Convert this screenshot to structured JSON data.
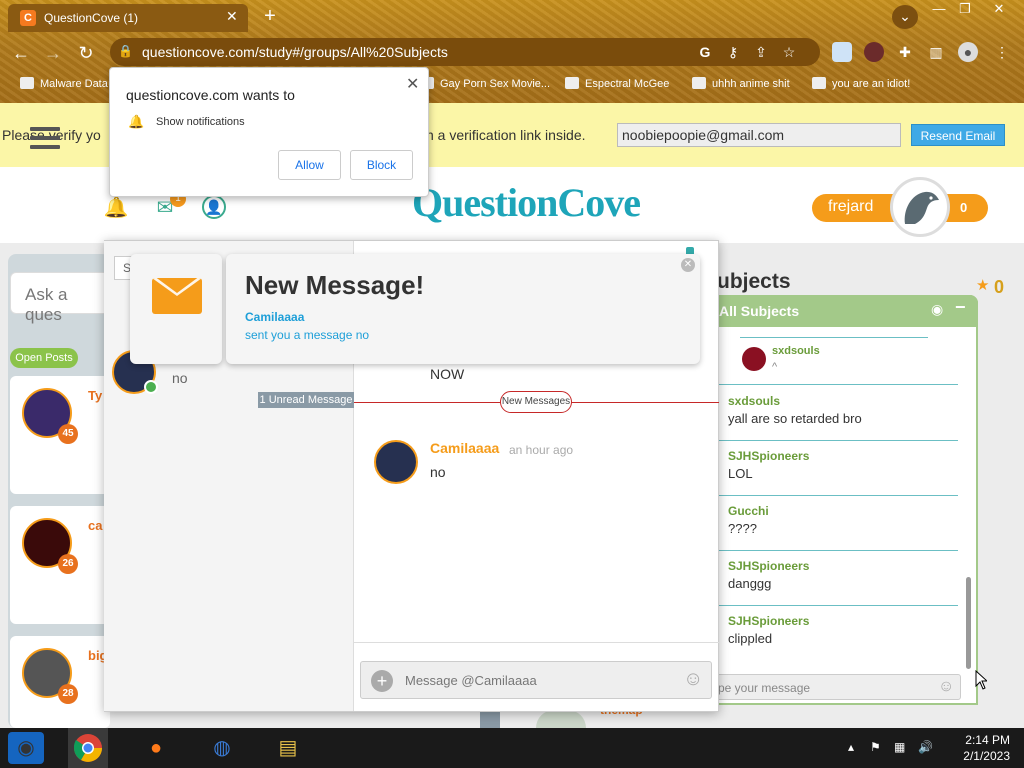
{
  "browser": {
    "tab_title": "QuestionCove (1)",
    "tab_favicon": "C",
    "url_main": "questioncove.com/study#/groups/All%20Subjects",
    "bookmarks": [
      "Malware Data",
      "Gay Porn Sex Movie...",
      "Espectral McGee",
      "uhhh anime shit",
      "you are an idiot!"
    ]
  },
  "notification_prompt": {
    "title": "questioncove.com wants to",
    "permission": "Show notifications",
    "allow": "Allow",
    "block": "Block"
  },
  "verify_bar": {
    "text_left": "Please verify yo",
    "text_right": "n a verification link inside.",
    "email": "noobiepoopie@gmail.com",
    "resend": "Resend Email"
  },
  "header": {
    "mail_badge": "1",
    "logo": "QuestionCove",
    "username": "frejard",
    "points": "0"
  },
  "left_col": {
    "ask_placeholder": "Ask a ques",
    "open_posts": "Open Posts",
    "cards": [
      {
        "name": "Ty",
        "badge": "45"
      },
      {
        "name": "ca",
        "badge": "26"
      },
      {
        "name": "big",
        "badge": "28"
      }
    ]
  },
  "messenger": {
    "search_stub": "S",
    "conv_preview": "no",
    "unread_label": "1 Unread Message",
    "new_messages_label": "New Messages",
    "earlier_msg": "NOW",
    "message": {
      "user": "Camilaaaa",
      "time": "an hour ago",
      "text": "no"
    },
    "composer_placeholder": "Message @Camilaaaa"
  },
  "toast": {
    "heading": "New Message!",
    "user": "Camilaaaa",
    "text": "sent you a message",
    "snippet": "no"
  },
  "subjects": {
    "title": "ubjects",
    "star_count": "0",
    "panel_title": "All Subjects",
    "top_entry": {
      "user": "sxdsouls",
      "msg": "^"
    },
    "messages": [
      {
        "user": "sxdsouls",
        "msg": "yall are so retarded bro"
      },
      {
        "user": "SJHSpioneers",
        "msg": "LOL"
      },
      {
        "user": "Gucchi",
        "msg": "????"
      },
      {
        "user": "SJHSpioneers",
        "msg": "danggg"
      },
      {
        "user": "SJHSpioneers",
        "msg": "clippled"
      }
    ],
    "type_placeholder": "pe your message",
    "bottom_peek": "themap"
  },
  "taskbar": {
    "time": "2:14 PM",
    "date": "2/1/2023"
  },
  "colors": {
    "accent_orange": "#f59c1a",
    "teal": "#1ea5b9",
    "green_panel": "#a3c989",
    "verify_bg": "#fbf6a7"
  }
}
